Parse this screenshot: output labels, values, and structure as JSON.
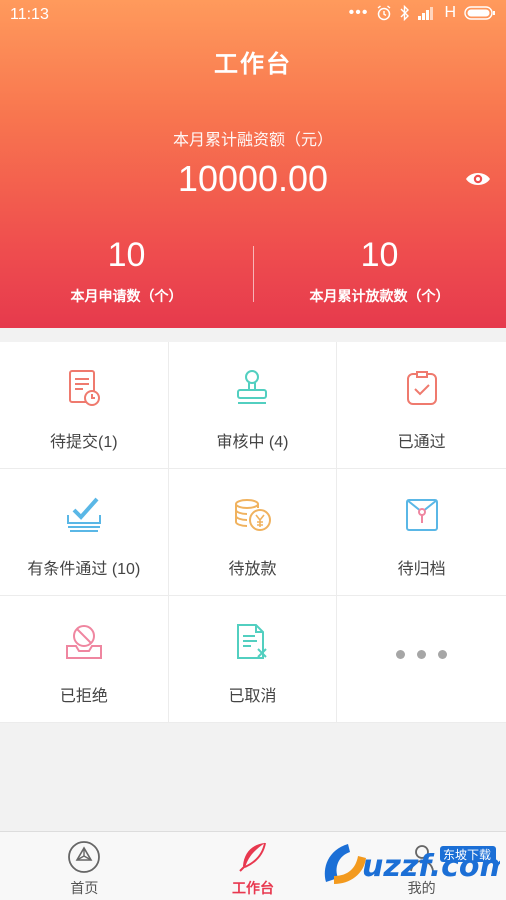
{
  "statusbar": {
    "time": "11:13",
    "dots": "•••",
    "network": "H"
  },
  "header": {
    "title": "工作台",
    "finance_label": "本月累计融资额（元）",
    "finance_amount": "10000.00"
  },
  "stats": [
    {
      "value": "10",
      "label": "本月申请数（个）"
    },
    {
      "value": "10",
      "label": "本月累计放款数（个）"
    }
  ],
  "grid": [
    {
      "label": "待提交(1)",
      "icon": "document-clock-icon"
    },
    {
      "label": "审核中 (4)",
      "icon": "stamp-icon"
    },
    {
      "label": "已通过",
      "icon": "clipboard-check-icon"
    },
    {
      "label": "有条件通过 (10)",
      "icon": "check-tray-icon"
    },
    {
      "label": "待放款",
      "icon": "coins-yen-icon"
    },
    {
      "label": "待归档",
      "icon": "envelope-archive-icon"
    },
    {
      "label": "已拒绝",
      "icon": "reject-tray-icon"
    },
    {
      "label": "已取消",
      "icon": "document-cancel-icon"
    },
    {
      "label": "",
      "icon": "more-icon"
    }
  ],
  "tabbar": [
    {
      "label": "首页",
      "icon": "home-wheel-icon"
    },
    {
      "label": "工作台",
      "icon": "feather-icon",
      "active": true
    },
    {
      "label": "我的",
      "icon": "profile-icon"
    }
  ],
  "colors": {
    "header_top": "#ff9a5c",
    "header_bottom": "#e63a4d",
    "active_tab": "#e8384f",
    "icon_red": "#ef7a6e",
    "icon_teal": "#52cfc0",
    "icon_blue": "#5ab7e6",
    "icon_orange": "#f0b25e",
    "icon_pink": "#ef86a0"
  },
  "watermark": {
    "text": "uzzf.com",
    "subtext": "东坡下载"
  }
}
